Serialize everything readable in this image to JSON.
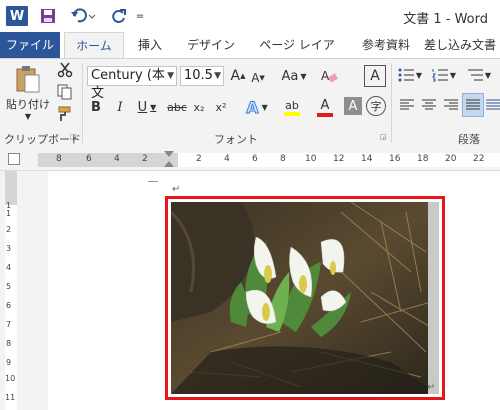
{
  "window": {
    "app_icon_label": "W",
    "title": "文書 1 - Word",
    "qat": {
      "save_icon": "save-icon",
      "undo_icon": "undo-icon",
      "redo_icon": "redo-icon",
      "more_label": "="
    }
  },
  "tabs": {
    "file": "ファイル",
    "home": "ホーム",
    "insert": "挿入",
    "design": "デザイン",
    "layout": "ページ レイアウト",
    "references": "参考資料",
    "mailings": "差し込み文書"
  },
  "ribbon": {
    "clipboard": {
      "paste_label": "貼り付け",
      "group_label": "クリップボード"
    },
    "font": {
      "font_name": "Century (本文",
      "font_size": "10.5",
      "grow_label": "A",
      "shrink_label": "A",
      "case_label": "Aa",
      "clear_label": "A",
      "bold": "B",
      "italic": "I",
      "underline": "U",
      "strike": "abc",
      "subscript": "x₂",
      "superscript": "x²",
      "text_effect": "A",
      "highlight": "ab",
      "font_color": "A",
      "char_shading": "A",
      "enclose": "字",
      "group_label": "フォント"
    },
    "paragraph": {
      "group_label": "段落"
    }
  },
  "ruler": {
    "h_labels": [
      "8",
      "6",
      "4",
      "2",
      "2",
      "4",
      "6",
      "8",
      "10",
      "12",
      "14",
      "16",
      "18",
      "20",
      "22"
    ],
    "v_labels": [
      "1",
      "1",
      "2",
      "3",
      "4",
      "5",
      "6",
      "7",
      "8",
      "9",
      "10",
      "11"
    ]
  },
  "document": {
    "para_mark": "↵",
    "picture_alt": "skunk cabbage flowers photo"
  },
  "colors": {
    "word_blue": "#2b579a",
    "selection_red": "#e8151b",
    "highlight_yellow": "#ffff00",
    "font_red": "#e01c1c"
  }
}
